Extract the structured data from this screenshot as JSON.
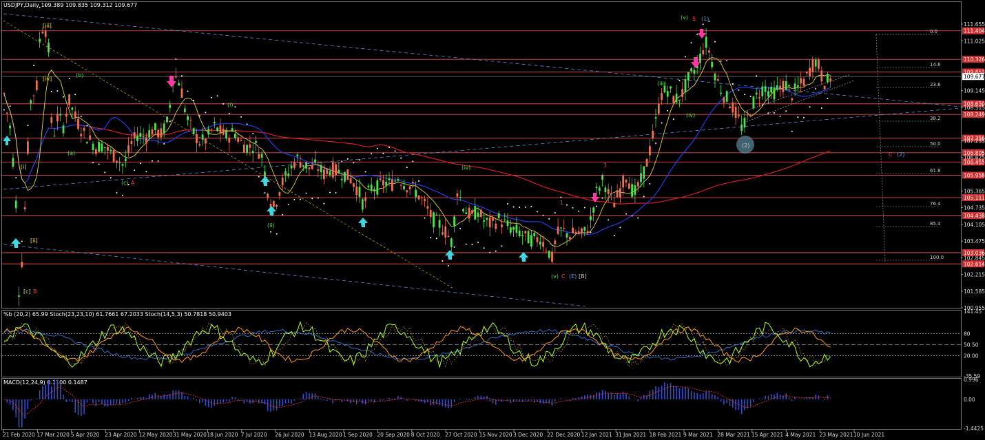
{
  "chart_data": {
    "type": "candlestick",
    "panes": {
      "price": {
        "header": "USDJPY,Daily  109.389 109.835 109.312 109.677",
        "ylim": [
          100.985,
          112.2
        ],
        "right_axis_ticks": [
          111.655,
          111.025,
          109.145,
          108.515,
          107.255,
          106.625,
          105.365,
          104.735,
          104.105,
          103.475,
          102.845,
          102.215,
          101.585,
          100.955
        ],
        "level_lines": [
          {
            "value": 111.404,
            "label": "111.404"
          },
          {
            "value": 110.326,
            "label": "110.326"
          },
          {
            "value": 109.853,
            "label": "109.853"
          },
          {
            "value": 108.65,
            "label": "108.650"
          },
          {
            "value": 108.249,
            "label": "108.249"
          },
          {
            "value": 107.356,
            "label": "107.356"
          },
          {
            "value": 106.805,
            "label": "106.805"
          },
          {
            "value": 106.455,
            "label": "106.455"
          },
          {
            "value": 105.958,
            "label": "105.958"
          },
          {
            "value": 105.111,
            "label": "105.111"
          },
          {
            "value": 104.438,
            "label": "104.438"
          },
          {
            "value": 103.036,
            "label": "103.036"
          },
          {
            "value": 102.614,
            "label": "102.614"
          }
        ],
        "last_price": {
          "value": 109.677,
          "label": "109.677"
        },
        "fib_levels": [
          "0.0",
          "14.6",
          "23.6",
          "38.2",
          "50.0",
          "61.8",
          "76.4",
          "85.4",
          "100.0"
        ],
        "wave_labels": [
          "[iii]",
          "[iv]",
          "[ii]",
          "[i]",
          "[c]",
          "B",
          "(b)",
          "(a)",
          "(c)",
          "A",
          "(i)",
          "(ii)",
          "(iv)",
          "(v)",
          "C",
          "(E)",
          "[B]",
          "1",
          "3",
          "5",
          "(1)",
          "(2)",
          "(iii)",
          "(iv)",
          "(v)",
          "C",
          "(2)"
        ]
      },
      "stoch": {
        "header": "%b (20,2) 65.99  Stoch(23,23,10) 61.7661 67.2033  Stoch(14,5,3) 50.7818 50.9403",
        "ylim": [
          -35.59,
          141.45
        ],
        "right_axis_ticks": [
          "141.45",
          "80",
          "50.50",
          "20.00",
          "-35.59"
        ]
      },
      "macd": {
        "header": "MACD(12,24,9) 0.1100 0.1487",
        "ylim": [
          -1.4425,
          0.996
        ],
        "right_axis_ticks": [
          "0.996",
          "0.00",
          "-1.4425"
        ]
      }
    },
    "x_ticks": [
      "21 Feb 2020",
      "17 Mar 2020",
      "5 Apr 2020",
      "23 Apr 2020",
      "12 May 2020",
      "31 May 2020",
      "18 Jun 2020",
      "7 Jul 2020",
      "26 Jul 2020",
      "13 Aug 2020",
      "1 Sep 2020",
      "20 Sep 2020",
      "8 Oct 2020",
      "27 Oct 2020",
      "15 Nov 2020",
      "3 Dec 2020",
      "22 Dec 2020",
      "12 Jan 2021",
      "31 Jan 2021",
      "18 Feb 2021",
      "9 Mar 2021",
      "28 Mar 2021",
      "15 Apr 2021",
      "4 May 2021",
      "23 May 2021",
      "10 Jun 2021"
    ],
    "price_path": [
      [
        0,
        110.3
      ],
      [
        8,
        108.6
      ],
      [
        16,
        107.6
      ],
      [
        24,
        104.6
      ],
      [
        28,
        101.2
      ],
      [
        34,
        103.6
      ],
      [
        40,
        106.8
      ],
      [
        46,
        109.3
      ],
      [
        52,
        108.8
      ],
      [
        58,
        111.2
      ],
      [
        64,
        111.7
      ],
      [
        70,
        111.0
      ],
      [
        76,
        107.2
      ],
      [
        84,
        108.2
      ],
      [
        92,
        107.8
      ],
      [
        100,
        108.8
      ],
      [
        110,
        108.1
      ],
      [
        120,
        107.6
      ],
      [
        130,
        107.3
      ],
      [
        140,
        107.0
      ],
      [
        150,
        107.1
      ],
      [
        160,
        106.8
      ],
      [
        170,
        106.6
      ],
      [
        180,
        106.3
      ],
      [
        190,
        107.1
      ],
      [
        200,
        107.5
      ],
      [
        210,
        107.4
      ],
      [
        222,
        107.7
      ],
      [
        234,
        107.5
      ],
      [
        244,
        108.0
      ],
      [
        252,
        109.8
      ],
      [
        262,
        109.4
      ],
      [
        270,
        108.2
      ],
      [
        280,
        107.6
      ],
      [
        290,
        107.2
      ],
      [
        300,
        107.3
      ],
      [
        310,
        107.8
      ],
      [
        320,
        107.6
      ],
      [
        330,
        107.4
      ],
      [
        340,
        107.6
      ],
      [
        350,
        107.2
      ],
      [
        360,
        107.0
      ],
      [
        370,
        107.1
      ],
      [
        380,
        106.7
      ],
      [
        390,
        105.2
      ],
      [
        398,
        104.7
      ],
      [
        408,
        105.6
      ],
      [
        420,
        106.1
      ],
      [
        430,
        106.6
      ],
      [
        440,
        106.4
      ],
      [
        450,
        106.2
      ],
      [
        460,
        106.3
      ],
      [
        470,
        106.0
      ],
      [
        480,
        106.2
      ],
      [
        490,
        106.1
      ],
      [
        500,
        106.0
      ],
      [
        510,
        105.8
      ],
      [
        520,
        105.4
      ],
      [
        528,
        104.8
      ],
      [
        538,
        105.5
      ],
      [
        548,
        105.5
      ],
      [
        558,
        105.7
      ],
      [
        568,
        105.6
      ],
      [
        578,
        105.9
      ],
      [
        588,
        105.6
      ],
      [
        598,
        105.5
      ],
      [
        608,
        105.2
      ],
      [
        618,
        104.8
      ],
      [
        628,
        104.3
      ],
      [
        638,
        104.1
      ],
      [
        648,
        103.8
      ],
      [
        656,
        103.4
      ],
      [
        664,
        105.4
      ],
      [
        674,
        104.7
      ],
      [
        684,
        104.4
      ],
      [
        694,
        104.6
      ],
      [
        704,
        104.2
      ],
      [
        714,
        104.1
      ],
      [
        724,
        104.3
      ],
      [
        734,
        104.1
      ],
      [
        744,
        103.9
      ],
      [
        754,
        103.8
      ],
      [
        764,
        103.6
      ],
      [
        774,
        103.5
      ],
      [
        784,
        103.6
      ],
      [
        794,
        103.2
      ],
      [
        802,
        102.8
      ],
      [
        808,
        103.7
      ],
      [
        816,
        103.9
      ],
      [
        826,
        103.7
      ],
      [
        836,
        103.8
      ],
      [
        846,
        103.7
      ],
      [
        856,
        104.1
      ],
      [
        866,
        105.3
      ],
      [
        876,
        105.8
      ],
      [
        884,
        105.2
      ],
      [
        892,
        104.9
      ],
      [
        900,
        105.4
      ],
      [
        910,
        106.0
      ],
      [
        920,
        105.2
      ],
      [
        930,
        105.7
      ],
      [
        940,
        106.5
      ],
      [
        950,
        107.7
      ],
      [
        960,
        109.0
      ],
      [
        970,
        109.2
      ],
      [
        980,
        108.8
      ],
      [
        990,
        109.0
      ],
      [
        1000,
        109.6
      ],
      [
        1010,
        110.0
      ],
      [
        1018,
        110.5
      ],
      [
        1024,
        111.0
      ],
      [
        1030,
        110.6
      ],
      [
        1040,
        109.6
      ],
      [
        1050,
        109.0
      ],
      [
        1060,
        108.7
      ],
      [
        1070,
        108.2
      ],
      [
        1078,
        107.7
      ],
      [
        1084,
        108.0
      ],
      [
        1092,
        108.6
      ],
      [
        1100,
        109.0
      ],
      [
        1110,
        109.3
      ],
      [
        1120,
        109.0
      ],
      [
        1130,
        109.2
      ],
      [
        1140,
        109.4
      ],
      [
        1150,
        109.0
      ],
      [
        1160,
        109.3
      ],
      [
        1170,
        109.6
      ],
      [
        1178,
        110.1
      ],
      [
        1186,
        110.3
      ],
      [
        1194,
        109.6
      ],
      [
        1200,
        109.4
      ],
      [
        1207,
        109.7
      ]
    ]
  }
}
